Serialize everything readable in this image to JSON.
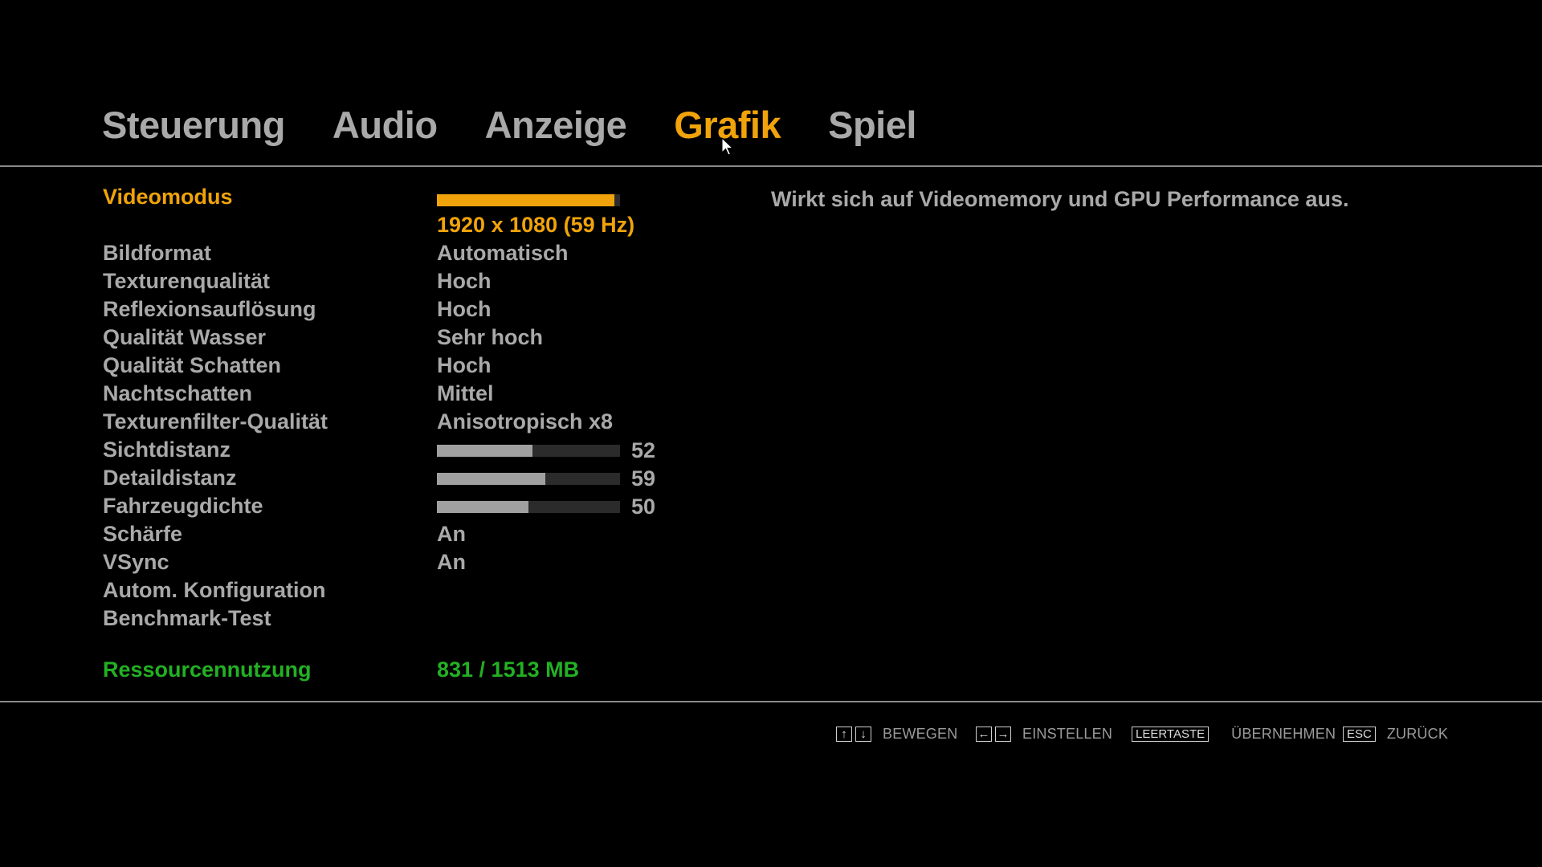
{
  "tabs": [
    {
      "label": "Steuerung",
      "active": false
    },
    {
      "label": "Audio",
      "active": false
    },
    {
      "label": "Anzeige",
      "active": false
    },
    {
      "label": "Grafik",
      "active": true
    },
    {
      "label": "Spiel",
      "active": false
    }
  ],
  "settings": {
    "videomodus": {
      "label": "Videomodus",
      "value": "1920 x 1080 (59 Hz)",
      "bar_fraction": 0.97
    },
    "bildformat": {
      "label": "Bildformat",
      "value": "Automatisch"
    },
    "texturenqualitaet": {
      "label": "Texturenqualität",
      "value": "Hoch"
    },
    "reflexion": {
      "label": "Reflexionsauflösung",
      "value": "Hoch"
    },
    "wasser": {
      "label": "Qualität Wasser",
      "value": "Sehr hoch"
    },
    "schatten": {
      "label": "Qualität Schatten",
      "value": "Hoch"
    },
    "nachtschatten": {
      "label": "Nachtschatten",
      "value": "Mittel"
    },
    "texturenfilter": {
      "label": "Texturenfilter-Qualität",
      "value": "Anisotropisch x8"
    },
    "sichtdistanz": {
      "label": "Sichtdistanz",
      "value": "52",
      "fraction": 0.52
    },
    "detaildistanz": {
      "label": "Detaildistanz",
      "value": "59",
      "fraction": 0.59
    },
    "fahrzeugdichte": {
      "label": "Fahrzeugdichte",
      "value": "50",
      "fraction": 0.5
    },
    "schaerfe": {
      "label": "Schärfe",
      "value": "An"
    },
    "vsync": {
      "label": "VSync",
      "value": "An"
    },
    "autokonfig": {
      "label": "Autom. Konfiguration"
    },
    "benchmark": {
      "label": "Benchmark-Test"
    }
  },
  "resource": {
    "label": "Ressourcennutzung",
    "value": "831 / 1513 MB"
  },
  "description": "Wirkt sich auf Videomemory und GPU Performance aus.",
  "hints": {
    "move": {
      "keys": [
        "↑",
        "↓"
      ],
      "label": "BEWEGEN"
    },
    "adjust": {
      "keys": [
        "←",
        "→"
      ],
      "label": "EINSTELLEN"
    },
    "apply": {
      "key": "LEERTASTE",
      "label": "ÜBERNEHMEN"
    },
    "back": {
      "key": "ESC",
      "label": "ZURÜCK"
    }
  },
  "colors": {
    "accent": "#f0a30a",
    "text": "#a9a9a9",
    "resource": "#23b023",
    "background": "#000000"
  },
  "icons": {
    "cursor": "mouse-pointer-icon"
  }
}
